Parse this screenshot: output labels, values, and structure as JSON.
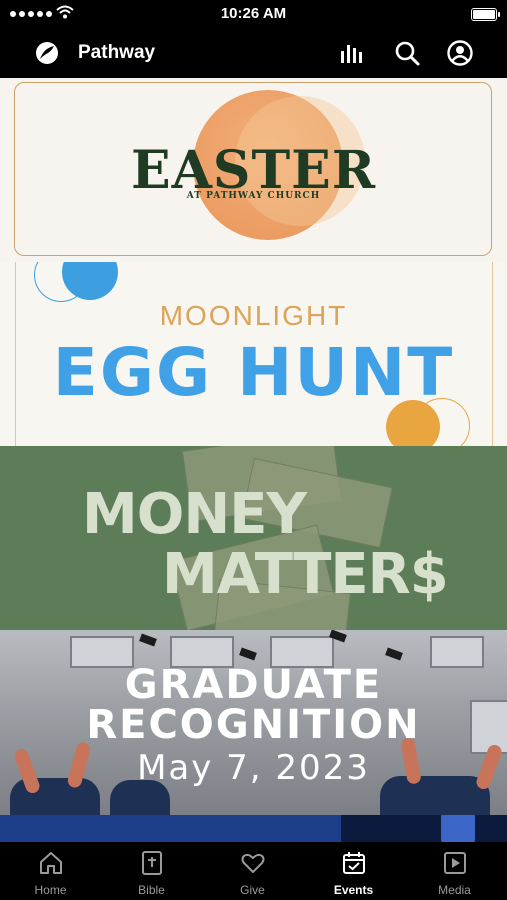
{
  "status_bar": {
    "time": "10:26 AM"
  },
  "app": {
    "name": "Pathway"
  },
  "header_icons": [
    "chart-bars-icon",
    "search-icon",
    "profile-icon"
  ],
  "cards": {
    "easter": {
      "title": "EASTER",
      "subtitle": "AT PATHWAY CHURCH"
    },
    "egg_hunt": {
      "line1": "MOONLIGHT",
      "line2": "EGG HUNT"
    },
    "money": {
      "line1": "MONEY",
      "line2": "MATTER$"
    },
    "graduate": {
      "line1": "GRADUATE",
      "line2": "RECOGNITION",
      "date": "May 7, 2023"
    }
  },
  "tabs": [
    {
      "label": "Home",
      "icon": "home-icon",
      "active": false
    },
    {
      "label": "Bible",
      "icon": "bible-icon",
      "active": false
    },
    {
      "label": "Give",
      "icon": "heart-icon",
      "active": false
    },
    {
      "label": "Events",
      "icon": "calendar-check-icon",
      "active": true
    },
    {
      "label": "Media",
      "icon": "play-icon",
      "active": false
    }
  ],
  "colors": {
    "accent": "#ffffff",
    "inactive_tab": "#9a9a9a",
    "bar_bg": "#000000"
  }
}
